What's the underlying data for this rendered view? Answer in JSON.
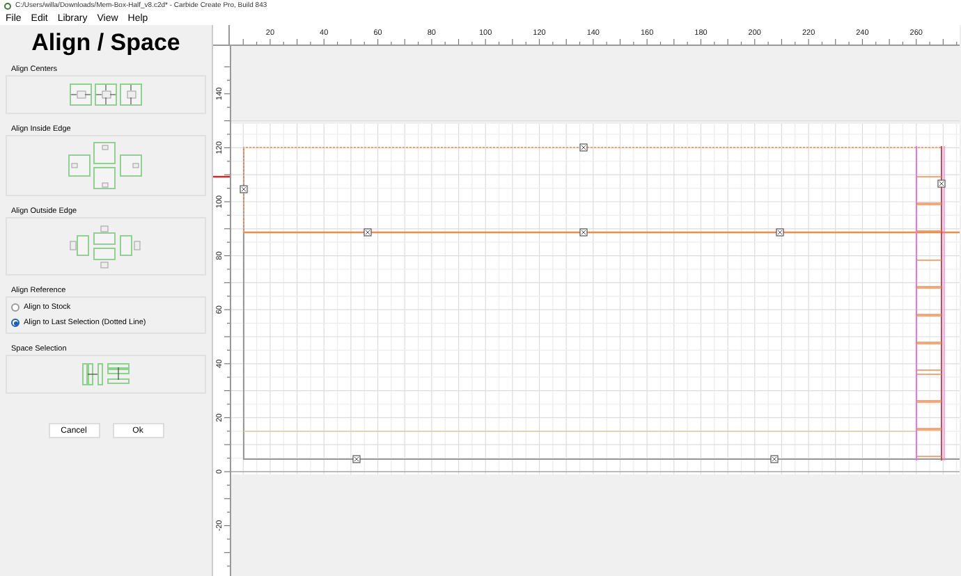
{
  "window": {
    "title": "C:/Users/willa/Downloads/Mem-Box-Half_v8.c2d* - Carbide Create Pro, Build 843"
  },
  "menu": [
    "File",
    "Edit",
    "Library",
    "View",
    "Help"
  ],
  "panel": {
    "title": "Align / Space",
    "sections": [
      {
        "kind": "centers",
        "label": "Align Centers"
      },
      {
        "kind": "inside",
        "label": "Align Inside Edge"
      },
      {
        "kind": "outside",
        "label": "Align Outside Edge"
      },
      {
        "kind": "reference",
        "label": "Align Reference",
        "options": [
          {
            "label": "Align to Stock",
            "selected": false
          },
          {
            "label": "Align to Last Selection (Dotted Line)",
            "selected": true
          }
        ]
      },
      {
        "kind": "space",
        "label": "Space Selection"
      }
    ],
    "buttons": [
      "Cancel",
      "Ok"
    ]
  },
  "rulers": {
    "horizontal": [
      "20",
      "40",
      "60",
      "80",
      "100",
      "120",
      "140",
      "160",
      "180",
      "200",
      "220",
      "240",
      "260"
    ],
    "vertical": [
      "140",
      "120",
      "100",
      "80",
      "60",
      "40",
      "20",
      "0",
      "-20"
    ]
  }
}
